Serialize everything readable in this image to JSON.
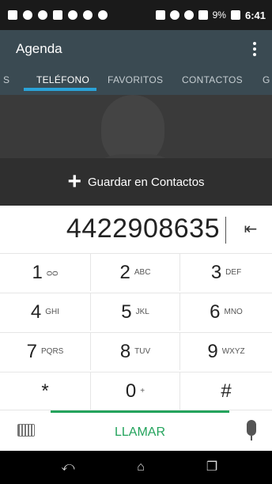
{
  "status_bar": {
    "battery_percent": "9%",
    "time": "6:41"
  },
  "app_bar": {
    "title": "Agenda",
    "menu_icon": "more-vert-icon"
  },
  "tabs": [
    {
      "label": "S",
      "active": false
    },
    {
      "label": "TELÉFONO",
      "active": true
    },
    {
      "label": "FAVORITOS",
      "active": false
    },
    {
      "label": "CONTACTOS",
      "active": false
    },
    {
      "label": "G",
      "active": false
    }
  ],
  "save_contact": {
    "label": "Guardar en Contactos",
    "icon": "plus-icon"
  },
  "dialer": {
    "number": "4422908635",
    "backspace_icon": "backspace-icon"
  },
  "keys": [
    {
      "digit": "1",
      "letters": "ᴑᴑ"
    },
    {
      "digit": "2",
      "letters": "ABC"
    },
    {
      "digit": "3",
      "letters": "DEF"
    },
    {
      "digit": "4",
      "letters": "GHI"
    },
    {
      "digit": "5",
      "letters": "JKL"
    },
    {
      "digit": "6",
      "letters": "MNO"
    },
    {
      "digit": "7",
      "letters": "PQRS"
    },
    {
      "digit": "8",
      "letters": "TUV"
    },
    {
      "digit": "9",
      "letters": "WXYZ"
    },
    {
      "digit": "*",
      "letters": ""
    },
    {
      "digit": "0",
      "letters": "+"
    },
    {
      "digit": "#",
      "letters": ""
    }
  ],
  "call_bar": {
    "call_label": "LLAMAR",
    "keyboard_icon": "keyboard-icon",
    "mic_icon": "microphone-icon"
  },
  "nav_bar": {
    "back": "⤺",
    "home": "⌂",
    "recents": "❐"
  },
  "colors": {
    "accent_blue": "#2aa3d8",
    "call_green": "#23a35c",
    "app_bar": "#3a4a52"
  }
}
